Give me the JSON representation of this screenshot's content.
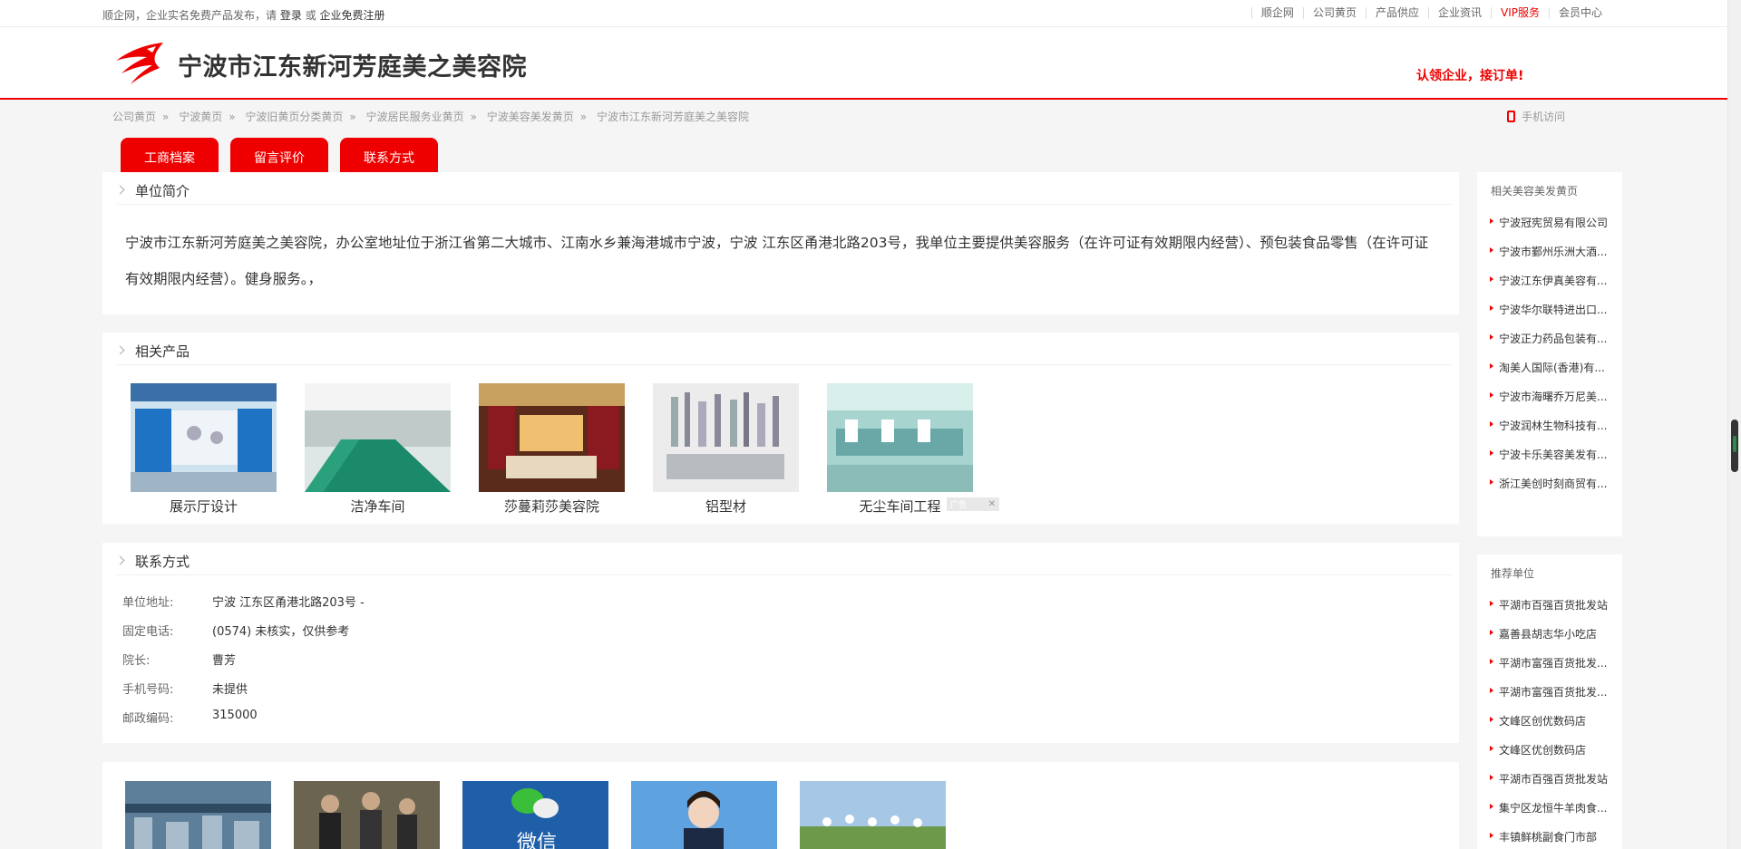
{
  "topbar": {
    "welcome_prefix": "顺企网，企业实名免费产品发布，请",
    "login": "登录",
    "or": "或",
    "register": "企业免费注册",
    "nav": [
      {
        "label": "顺企网"
      },
      {
        "label": "公司黄页"
      },
      {
        "label": "产品供应"
      },
      {
        "label": "企业资讯"
      },
      {
        "label": "VIP服务"
      },
      {
        "label": "会员中心"
      }
    ]
  },
  "header": {
    "title": "宁波市江东新河芳庭美之美容院",
    "claim": "认领企业，接订单!"
  },
  "breadcrumb": [
    "公司黄页",
    "宁波黄页",
    "宁波旧黄页分类黄页",
    "宁波居民服务业黄页",
    "宁波美容美发黄页",
    "宁波市江东新河芳庭美之美容院"
  ],
  "mobile_label": "手机访问",
  "tabs": [
    {
      "label": "工商档案"
    },
    {
      "label": "留言评价"
    },
    {
      "label": "联系方式"
    }
  ],
  "intro": {
    "heading": "单位简介",
    "text": "宁波市江东新河芳庭美之美容院，办公室地址位于浙江省第二大城市、江南水乡兼海港城市宁波，宁波 江东区甬港北路203号，我单位主要提供美容服务（在许可证有效期限内经营）、预包装食品零售（在许可证有效期限内经营）。健身服务。，"
  },
  "products": {
    "heading": "相关产品",
    "items": [
      {
        "caption": "展示厅设计"
      },
      {
        "caption": "洁净车间"
      },
      {
        "caption": "莎蔓莉莎美容院"
      },
      {
        "caption": "铝型材"
      },
      {
        "caption": "无尘车间工程"
      }
    ],
    "ad_label": "广告"
  },
  "contact": {
    "heading": "联系方式",
    "rows": [
      {
        "label": "单位地址:",
        "value": "宁波 江东区甬港北路203号 -"
      },
      {
        "label": "固定电话:",
        "value": "(0574) 未核实，仅供参考"
      },
      {
        "label": "院长:",
        "value": "曹芳"
      },
      {
        "label": "手机号码:",
        "value": "未提供"
      },
      {
        "label": "邮政编码:",
        "value": "315000"
      }
    ]
  },
  "banners": {
    "wechat_text": "微信"
  },
  "sidebar": {
    "related_title": "相关美容美发黄页",
    "related": [
      "宁波冠宪贸易有限公司",
      "宁波市鄞州乐洲大酒...",
      "宁波江东伊真美容有...",
      "宁波华尔联特进出口...",
      "宁波正力药品包装有...",
      "淘美人国际(香港)有...",
      "宁波市海曙乔万尼美...",
      "宁波润林生物科技有...",
      "宁波卡乐美容美发有...",
      "浙江美创时刻商贸有..."
    ],
    "recommend_title": "推荐单位",
    "recommend": [
      "平湖市百强百货批发站",
      "嘉善县胡志华小吃店",
      "平湖市富强百货批发...",
      "平湖市富强百货批发...",
      "文峰区创优数码店",
      "文峰区优创数码店",
      "平湖市百强百货批发站",
      "集宁区龙恒牛羊肉食...",
      "丰镇鲜桃副食门市部"
    ]
  },
  "colors": {
    "accent": "#e00000"
  }
}
